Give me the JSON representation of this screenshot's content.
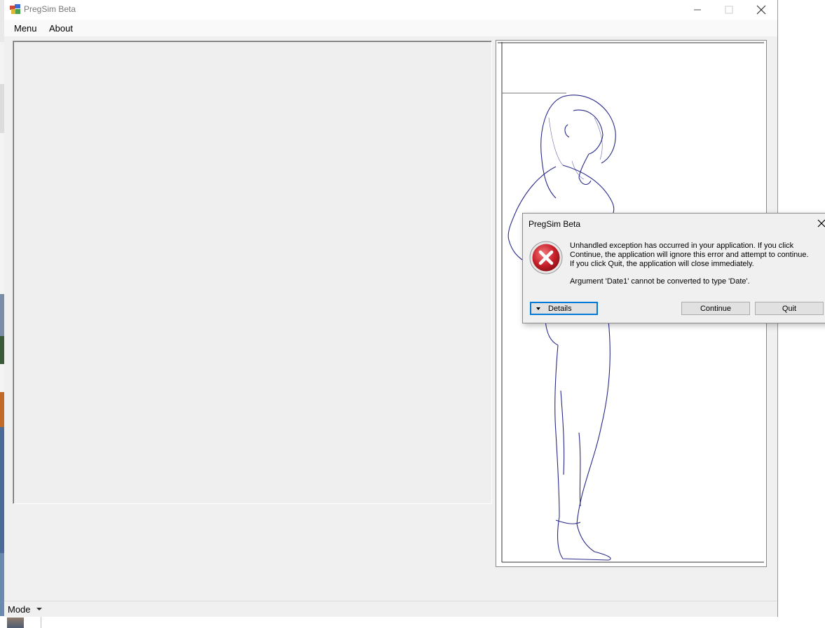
{
  "window": {
    "title": "PregSim Beta",
    "controls": {
      "minimize": "minimize-icon",
      "maximize": "maximize-icon",
      "close": "close-icon"
    }
  },
  "menubar": {
    "items": [
      {
        "label": "Menu"
      },
      {
        "label": "About"
      }
    ]
  },
  "statusbar": {
    "mode_label": "Mode"
  },
  "dialog": {
    "title": "PregSim Beta",
    "icon": "error-x-icon",
    "message": "Unhandled exception has occurred in your application. If you click Continue, the application will ignore this error and attempt to continue. If you click Quit, the application will close immediately.",
    "argument_message": "Argument 'Date1' cannot be converted to type 'Date'.",
    "buttons": {
      "details": "Details",
      "continue": "Continue",
      "quit": "Quit"
    }
  },
  "colors": {
    "window_bg": "#f0f0f0",
    "dialog_focus": "#0078d7",
    "error_red": "#c8202a",
    "sketch_line": "#2a2a8a"
  }
}
